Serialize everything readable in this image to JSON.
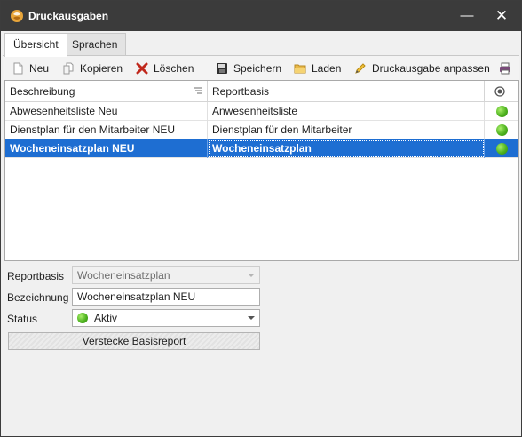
{
  "window": {
    "title": "Druckausgaben",
    "minimize_glyph": "—",
    "close_glyph": "✕"
  },
  "tabs": [
    {
      "label": "Übersicht",
      "active": true
    },
    {
      "label": "Sprachen",
      "active": false
    }
  ],
  "toolbar": {
    "new_label": "Neu",
    "copy_label": "Kopieren",
    "delete_label": "Löschen",
    "save_label": "Speichern",
    "load_label": "Laden",
    "customize_label": "Druckausgabe anpassen",
    "icons": [
      "document-icon",
      "copy-icon",
      "delete-icon",
      "save-icon",
      "folder-icon",
      "pencil-icon",
      "printer-icon"
    ]
  },
  "grid": {
    "columns": [
      "Beschreibung",
      "Reportbasis",
      ""
    ],
    "rows": [
      {
        "description": "Abwesenheitsliste Neu",
        "report_base": "Anwesenheitsliste",
        "status": "active",
        "selected": false
      },
      {
        "description": "Dienstplan für den Mitarbeiter NEU",
        "report_base": "Dienstplan für den Mitarbeiter",
        "status": "active",
        "selected": false
      },
      {
        "description": "Wocheneinsatzplan NEU",
        "report_base": "Wocheneinsatzplan",
        "status": "active",
        "selected": true
      }
    ]
  },
  "form": {
    "report_base_label": "Reportbasis",
    "report_base_value": "Wocheneinsatzplan",
    "name_label": "Bezeichnung",
    "name_value": "Wocheneinsatzplan NEU",
    "status_label": "Status",
    "status_value": "Aktiv",
    "hide_base_button": "Verstecke Basisreport"
  },
  "colors": {
    "titlebar": "#3b3b3b",
    "selection": "#1e6ed2",
    "status_active": "#4fb320",
    "delete_red": "#c0281c"
  }
}
